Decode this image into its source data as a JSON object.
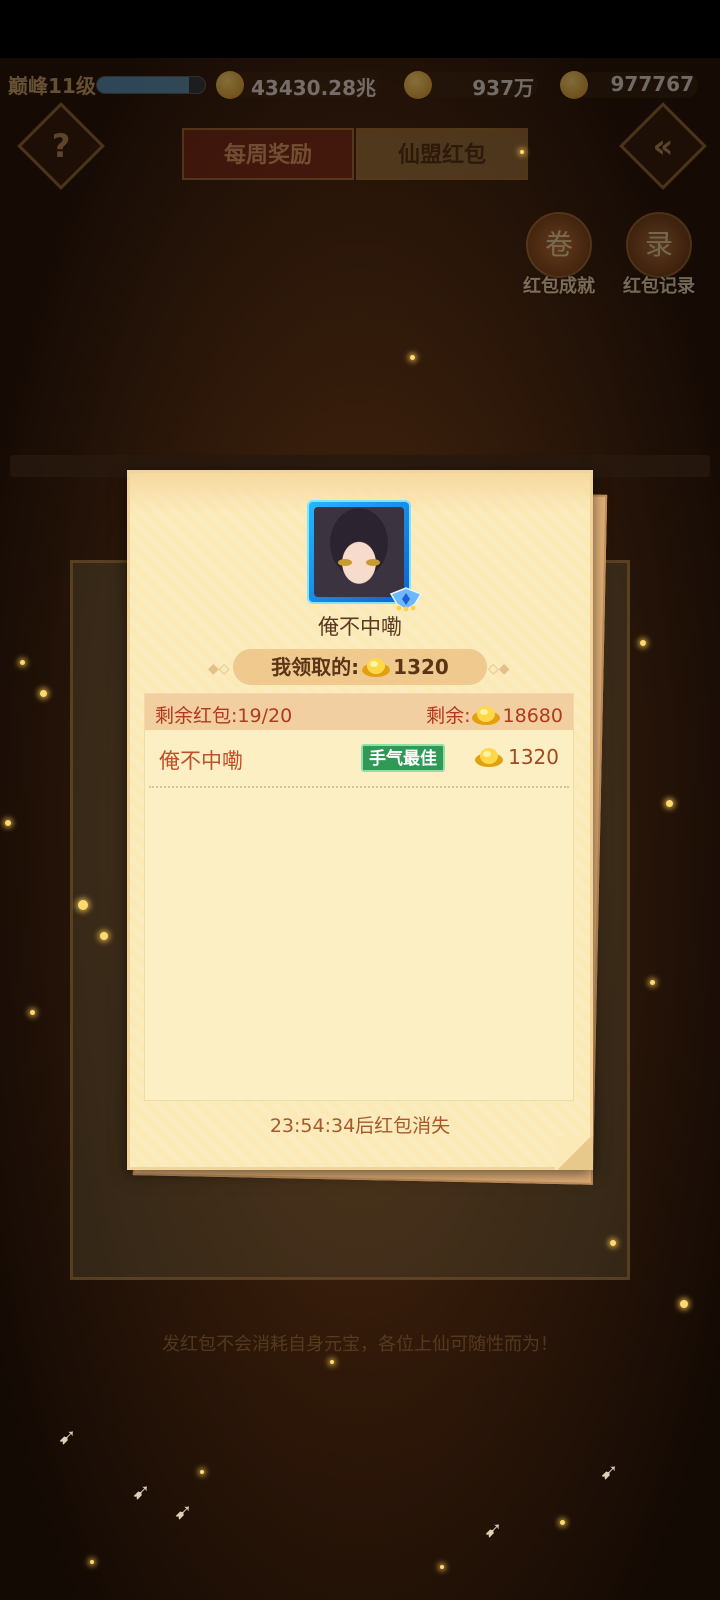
{
  "topbar": {
    "level": "巅峰11级",
    "xp_progress": 0.85,
    "power": "43430.28兆",
    "coins": "937万",
    "ingots": "977767"
  },
  "tabs": [
    {
      "label": "每周奖励"
    },
    {
      "label": "仙盟红包"
    }
  ],
  "side_buttons": {
    "achievement": "红包成就",
    "records": "红包记录"
  },
  "bottom_tip": "发红包不会消耗自身元宝，各位上仙可随性而为！",
  "popup": {
    "sender_name": "俺不中嘞",
    "my_claim_label": "我领取的:",
    "my_claim_amount": "1320",
    "remaining_packets_label": "剩余红包:19/20",
    "remaining_amount_label": "剩余:",
    "remaining_amount": "18680",
    "claims": [
      {
        "name": "俺不中嘞",
        "badge": "手气最佳",
        "amount": "1320"
      }
    ],
    "timer_text": "23:54:34后红包消失"
  },
  "colors": {
    "popup_bg": "#fbe9b6",
    "header_text": "#b03a1e",
    "best_badge": "#2e9a55"
  }
}
